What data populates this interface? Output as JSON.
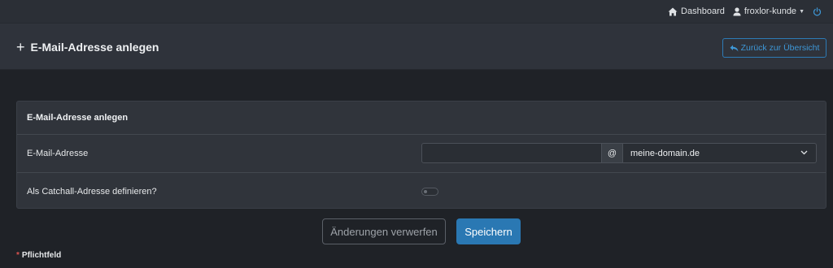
{
  "topnav": {
    "dashboard_label": "Dashboard",
    "user_label": "froxlor-kunde"
  },
  "header": {
    "title": "E-Mail-Adresse anlegen",
    "back_label": "Zurück zur Übersicht"
  },
  "form": {
    "card_title": "E-Mail-Adresse anlegen",
    "email": {
      "label": "E-Mail-Adresse",
      "value": "",
      "at_sign": "@",
      "domain_selected": "meine-domain.de"
    },
    "catchall": {
      "label": "Als Catchall-Adresse definieren?",
      "enabled": false
    }
  },
  "actions": {
    "discard_label": "Änderungen verwerfen",
    "save_label": "Speichern"
  },
  "footnote": {
    "marker": "*",
    "text": "Pflichtfeld"
  },
  "colors": {
    "accent": "#2a78b3",
    "background": "#1f2227",
    "card": "#30343b",
    "required": "#d9534f"
  }
}
